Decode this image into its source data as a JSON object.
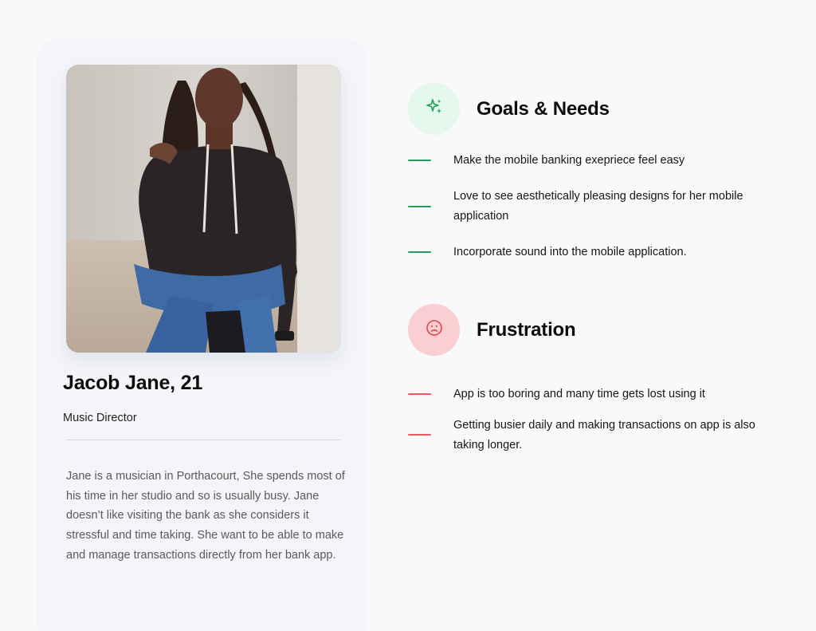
{
  "profile": {
    "name": "Jacob Jane, 21",
    "role": "Music Director",
    "bio": "Jane is a musician in Porthacourt, She spends most of his time in her studio and so is usually busy. Jane doesn’t like visiting the bank as she considers it stressful and time taking. She want to be able to make and manage transactions directly from her bank app."
  },
  "goals": {
    "title": "Goals & Needs",
    "icon": "sparkle-icon",
    "accent": "#22a05a",
    "items": [
      "Make the mobile banking exepriece feel easy",
      "Love to see aesthetically pleasing designs for her mobile application",
      "Incorporate sound into the mobile application."
    ]
  },
  "frustration": {
    "title": "Frustration",
    "icon": "sad-face-icon",
    "accent": "#ec5a5f",
    "items": [
      "App is too boring and many time gets lost using it",
      "Getting busier daily and making transactions on app is also taking longer."
    ]
  }
}
